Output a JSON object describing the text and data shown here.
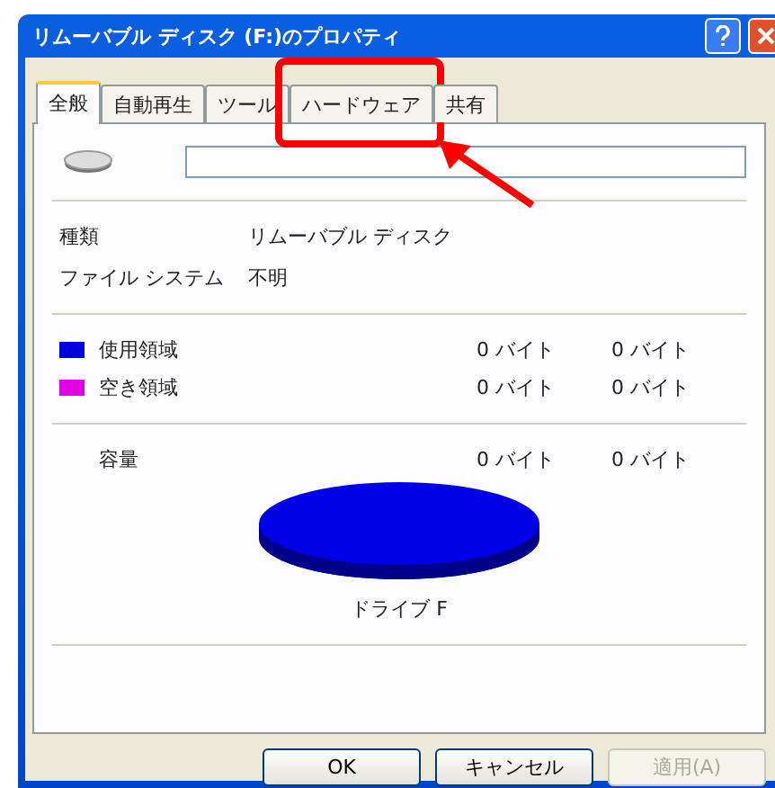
{
  "window": {
    "title": "リムーバブル ディスク (F:)のプロパティ"
  },
  "tabs": [
    {
      "label": "全般",
      "selected": true,
      "highlighted": false
    },
    {
      "label": "自動再生",
      "selected": false,
      "highlighted": false
    },
    {
      "label": "ツール",
      "selected": false,
      "highlighted": false
    },
    {
      "label": "ハードウェア",
      "selected": false,
      "highlighted": true
    },
    {
      "label": "共有",
      "selected": false,
      "highlighted": false
    }
  ],
  "info": [
    {
      "label": "種類",
      "value": "リムーバブル ディスク"
    },
    {
      "label": "ファイル システム",
      "value": "不明"
    }
  ],
  "usage": [
    {
      "label": "使用領域",
      "color": "#0000e0",
      "bytes": "0 バイト",
      "size": "0 バイト"
    },
    {
      "label": "空き領域",
      "color": "#e000e0",
      "bytes": "0 バイト",
      "size": "0 バイト"
    }
  ],
  "capacity": {
    "label": "容量",
    "bytes": "0 バイト",
    "size": "0 バイト"
  },
  "drive_label": "ドライブ F",
  "buttons": [
    {
      "label": "OK",
      "disabled": false
    },
    {
      "label": "キャンセル",
      "disabled": false
    },
    {
      "label": "適用(A)",
      "disabled": true
    }
  ]
}
